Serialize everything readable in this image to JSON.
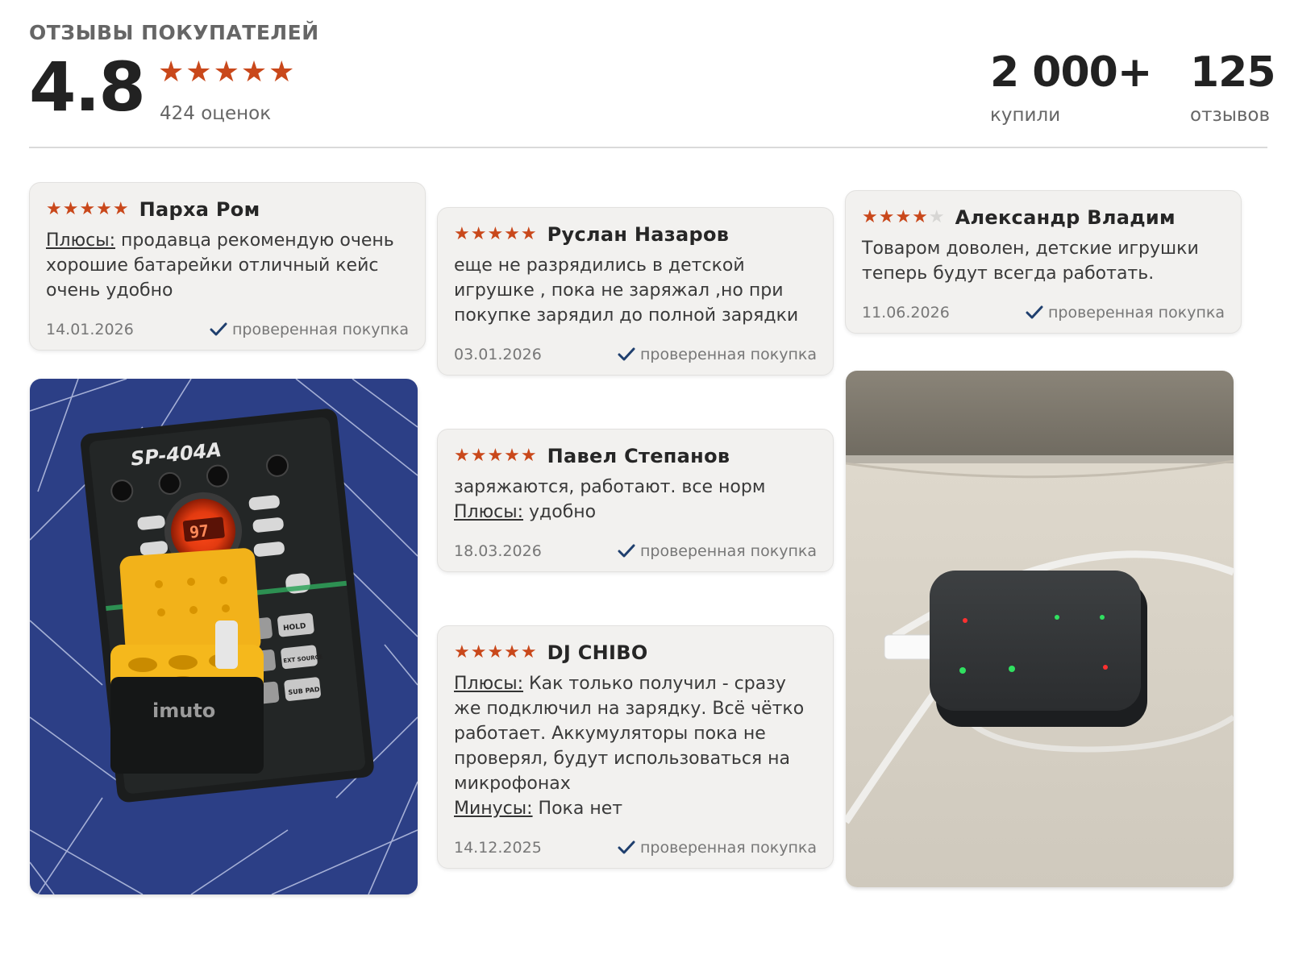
{
  "header": {
    "title": "ОТЗЫВЫ ПОКУПАТЕЛЕЙ",
    "rating": "4.8",
    "rating_stars": 5,
    "ratings_count": "424 оценок",
    "bought_value": "2 000+",
    "bought_label": "купили",
    "reviews_value": "125",
    "reviews_label": "отзывов"
  },
  "colors": {
    "star": "#c9481b",
    "card_bg": "#f2f1ef",
    "check": "#1f3f6e"
  },
  "verified_label": "проверенная покупка",
  "reviews": [
    {
      "author": "Парха Ром",
      "stars": 5,
      "pros_label": "Плюсы:",
      "text": " продавца рекомендую очень хорошие батарейки отличный кейс очень удобно",
      "date": "14.01.2026"
    },
    {
      "author": "Руслан Назаров",
      "stars": 5,
      "text": "еще не разрядились в детской игрушке , пока не заряжал ,но при покупке зарядил до полной зарядки",
      "date": "03.01.2026"
    },
    {
      "author": "Александр Владим",
      "stars": 4,
      "text": "Товаром доволен, детские игрушки теперь будут всегда работать.",
      "date": "11.06.2026"
    },
    {
      "author": "Павел Степанов",
      "stars": 5,
      "text": "заряжаются, работают. все норм",
      "pros_label": "Плюсы:",
      "pros_text": " удобно",
      "date": "18.03.2026"
    },
    {
      "author": "DJ CHIBO",
      "stars": 5,
      "pros_label": "Плюсы:",
      "text": " Как только получил - сразу же подключил на зарядку. Всё чётко работает. Аккумуляторы пока не проверял, будут использоваться на микрофонах",
      "cons_label": "Минусы:",
      "cons_text": " Пока нет",
      "date": "14.12.2025"
    }
  ],
  "photo_texts": {
    "device_model": "SP-404A",
    "case_brand": "imuto",
    "device_display": "97",
    "pad_hold": "HOLD",
    "pad_ext": "EXT SOURCE",
    "pad_sub": "SUB PAD"
  }
}
